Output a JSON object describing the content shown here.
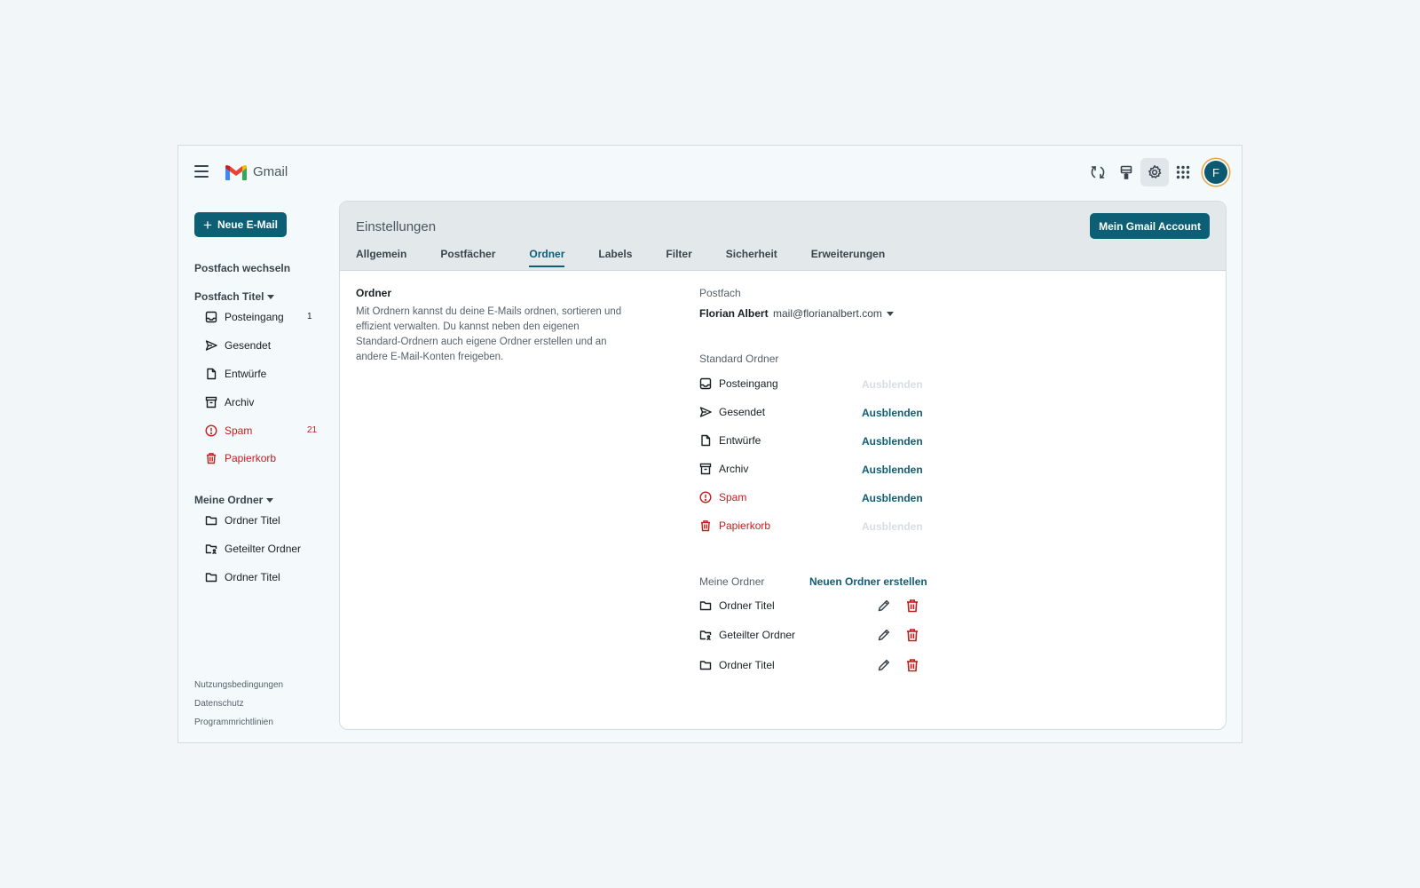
{
  "app": {
    "title": "Gmail"
  },
  "topbar": {
    "icons": [
      "refresh-icon",
      "paint-icon",
      "gear-icon",
      "apps-grid-icon"
    ],
    "avatar_initial": "F"
  },
  "sidebar": {
    "compose_label": "Neue E-Mail",
    "switch_mailbox": "Postfach wechseln",
    "mailbox_title": "Postfach Titel",
    "items": [
      {
        "label": "Posteingang",
        "icon": "inbox-icon",
        "count": "1"
      },
      {
        "label": "Gesendet",
        "icon": "send-icon"
      },
      {
        "label": "Entwürfe",
        "icon": "draft-icon"
      },
      {
        "label": "Archiv",
        "icon": "archive-icon"
      },
      {
        "label": "Spam",
        "icon": "spam-icon",
        "count": "21"
      },
      {
        "label": "Papierkorb",
        "icon": "trash-icon"
      }
    ],
    "my_folders_title": "Meine Ordner",
    "folders": [
      {
        "label": "Ordner Titel",
        "icon": "folder-icon"
      },
      {
        "label": "Geteilter Ordner",
        "icon": "shared-folder-icon"
      },
      {
        "label": "Ordner Titel",
        "icon": "folder-icon"
      }
    ],
    "footer": [
      "Nutzungsbedingungen",
      "Datenschutz",
      "Programmrichtlinien"
    ]
  },
  "settings": {
    "title": "Einstellungen",
    "account_button": "Mein Gmail Account",
    "tabs": [
      "Allgemein",
      "Postfächer",
      "Ordner",
      "Labels",
      "Filter",
      "Sicherheit",
      "Erweiterungen"
    ],
    "active_tab": "Ordner",
    "section_title": "Ordner",
    "section_description": "Mit Ordnern kannst du deine E-Mails ordnen, sortieren und effizient verwalten. Du kannst neben den eigenen Standard-Ordnern auch eigene Ordner erstellen und an andere E-Mail-Konten freigeben.",
    "mailbox_label": "Postfach",
    "account_name": "Florian Albert",
    "account_email": "mail@florianalbert.com",
    "standard_label": "Standard Ordner",
    "standard_folders": [
      {
        "label": "Posteingang",
        "action": "Ausblenden",
        "enabled": false
      },
      {
        "label": "Gesendet",
        "action": "Ausblenden",
        "enabled": true
      },
      {
        "label": "Entwürfe",
        "action": "Ausblenden",
        "enabled": true
      },
      {
        "label": "Archiv",
        "action": "Ausblenden",
        "enabled": true
      },
      {
        "label": "Spam",
        "action": "Ausblenden",
        "enabled": true
      },
      {
        "label": "Papierkorb",
        "action": "Ausblenden",
        "enabled": false
      }
    ],
    "my_folders_label": "Meine Ordner",
    "new_folder_label": "Neuen Ordner erstellen",
    "my_folders": [
      {
        "label": "Ordner Titel"
      },
      {
        "label": "Geteilter Ordner"
      },
      {
        "label": "Ordner Titel"
      }
    ]
  },
  "colors": {
    "accent": "#0d5f75",
    "danger": "#c21e1e",
    "background": "#f3f6f8",
    "panel_header": "#e3e8eb"
  }
}
